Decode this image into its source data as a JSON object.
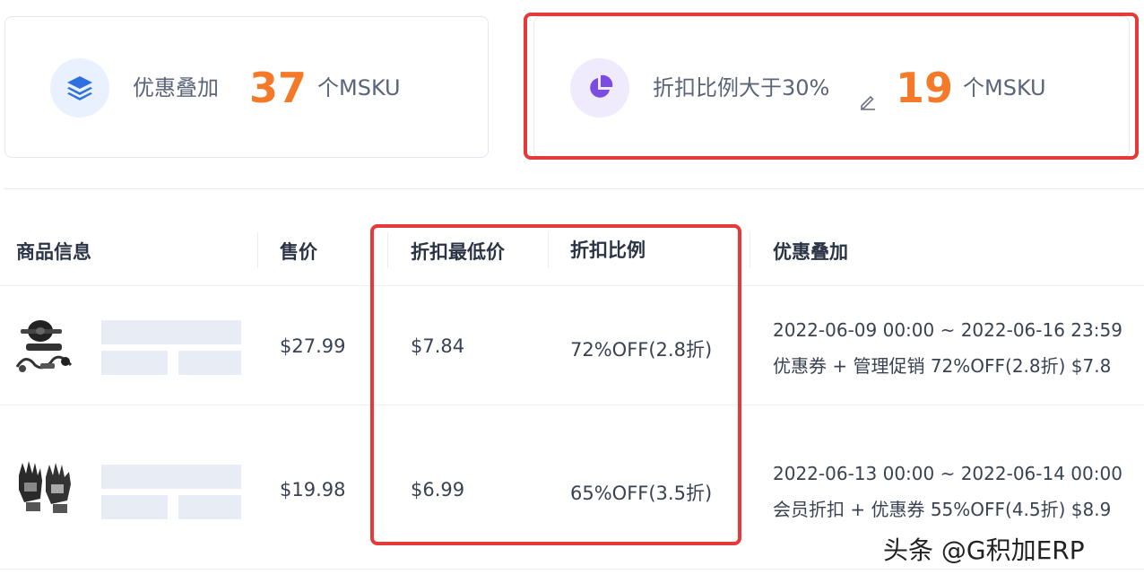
{
  "summary": {
    "stack": {
      "label": "优惠叠加",
      "count": "37",
      "unit": "个MSKU",
      "icon": "layers-icon"
    },
    "discount": {
      "label": "折扣比例大于30%",
      "count": "19",
      "unit": "个MSKU",
      "icon": "pie-chart-icon",
      "edit_icon": "pencil-icon"
    }
  },
  "table": {
    "headers": [
      "商品信息",
      "售价",
      "折扣最低价",
      "折扣比例",
      "优惠叠加"
    ],
    "rows": [
      {
        "price": "$27.99",
        "min_price": "$7.84",
        "ratio": "72%OFF(2.8折)",
        "promo_date": "2022-06-09 00:00 ~ 2022-06-16 23:59",
        "promo_desc": "优惠券 + 管理促销 72%OFF(2.8折) $7.8"
      },
      {
        "price": "$19.98",
        "min_price": "$6.99",
        "ratio": "65%OFF(3.5折)",
        "promo_date": "2022-06-13 00:00 ~ 2022-06-14 00:00",
        "promo_desc": "会员折扣 + 优惠券 55%OFF(4.5折) $8.9"
      }
    ]
  },
  "watermark": "头条 @G积加ERP",
  "colors": {
    "accent_orange": "#f47a2a",
    "highlight_red": "#e5393a",
    "icon_blue": "#2f6fe0",
    "icon_purple": "#7b4ce0"
  }
}
